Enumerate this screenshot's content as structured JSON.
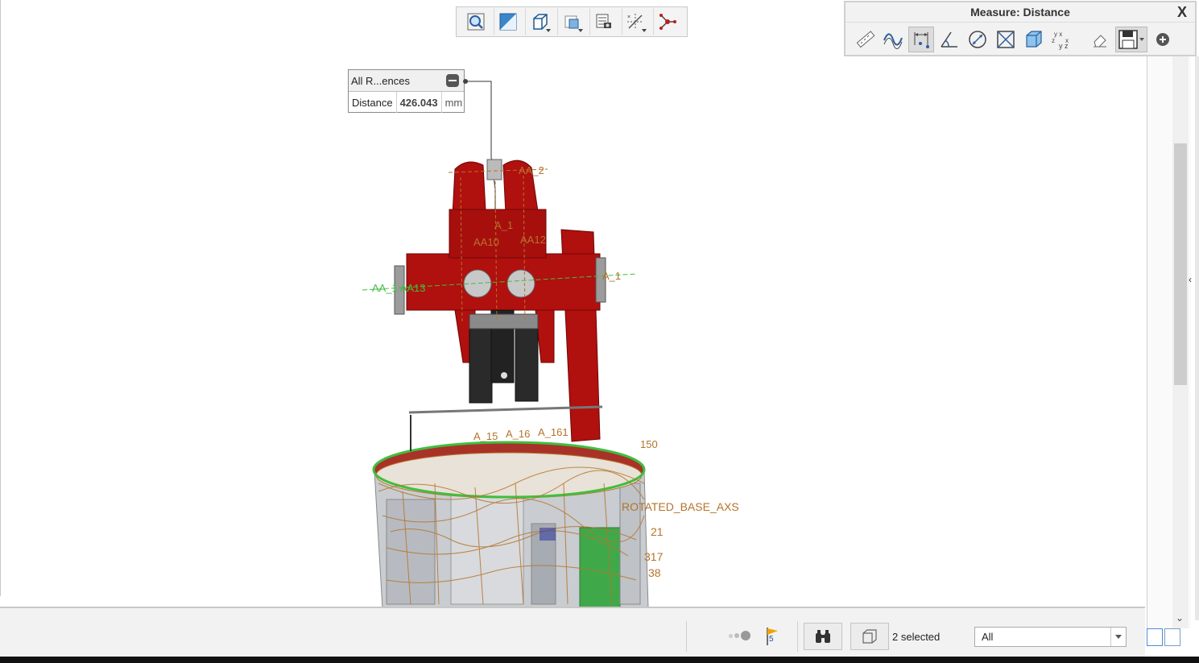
{
  "view_toolbar": {
    "buttons": [
      "refit-icon",
      "zoom-in-icon",
      "saved-orientation-icon",
      "display-style-icon",
      "view-manager-icon",
      "datum-display-icon",
      "spin-center-icon"
    ]
  },
  "measure_panel": {
    "title": "Measure: Distance",
    "close": "X",
    "tools": [
      "summary-icon",
      "length-icon",
      "distance-icon",
      "angle-icon",
      "diameter-icon",
      "area-icon",
      "volume-icon",
      "transform-icon"
    ],
    "active_tool": "distance-icon"
  },
  "callout": {
    "header": "All R...ences",
    "label": "Distance",
    "value": "426.043",
    "unit": "mm"
  },
  "model_labels": {
    "a2": "AA_2",
    "a1_top": "A_1",
    "aa10": "AA10",
    "aa12": "AA12",
    "aa_right": "A_1",
    "aa13": "AA_1 AA13",
    "a15": "A_15",
    "a16": "A_16",
    "a161": "A_161",
    "axs": "ROTATED_BASE_AXS",
    "n21": "21",
    "n317": "317",
    "n38": "38",
    "n150": "150"
  },
  "status_bar": {
    "flag_count": "5",
    "selected_text": "2 selected",
    "filter_value": "All"
  },
  "colors": {
    "model_red": "#b0100e",
    "datum_green": "#3fbf3f",
    "datum_orange": "#b5732a"
  }
}
